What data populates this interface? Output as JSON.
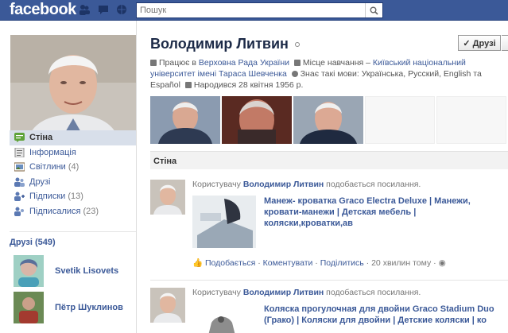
{
  "topbar": {
    "logo": "facebook",
    "search_placeholder": "Пошук"
  },
  "left": {
    "nav": [
      {
        "label": "Стіна",
        "count": ""
      },
      {
        "label": "Інформація",
        "count": ""
      },
      {
        "label": "Світлини",
        "count": "(4)"
      },
      {
        "label": "Друзі",
        "count": ""
      },
      {
        "label": "Підписки",
        "count": "(13)"
      },
      {
        "label": "Підписалися",
        "count": "(23)"
      }
    ],
    "friends_header": "Друзі (549)",
    "friends": [
      {
        "name": "Svetik Lisovets"
      },
      {
        "name": "Пётр Шуклинов"
      }
    ]
  },
  "profile": {
    "name": "Володимир Литвин",
    "friend_button": "✓ Друзі",
    "info": {
      "work_label": "Працює в",
      "work": "Верховна Рада України",
      "study_label": "Місце навчання –",
      "study": "Київський національний університет імені Тараса Шевченка",
      "languages_label": "Знає такі мови:",
      "languages": "Українська, Русский, English та Español",
      "born": "Народився 28 квітня 1956 р."
    }
  },
  "wall": {
    "header": "Стіна",
    "posts": [
      {
        "prefix": "Користувачу",
        "user": "Володимир Литвин",
        "suffix": "подобається посилання.",
        "link_title": "Манеж- кроватка Graco Electra Deluxe | Манежи, кровати-манежи | Детская мебель | коляски,кроватки,ав",
        "like": "Подобається",
        "comment": "Коментувати",
        "share": "Поділитись",
        "time": "20 хвилин тому"
      },
      {
        "prefix": "Користувачу",
        "user": "Володимир Литвин",
        "suffix": "подобається посилання.",
        "link_title": "Коляска прогулочная для двойни Graco Stadium Duo (Грако) | Коляски для двойни | Детские коляски | ко"
      }
    ]
  },
  "colors": {
    "brand": "#3b5998",
    "nav_active": "#d8dfea"
  }
}
